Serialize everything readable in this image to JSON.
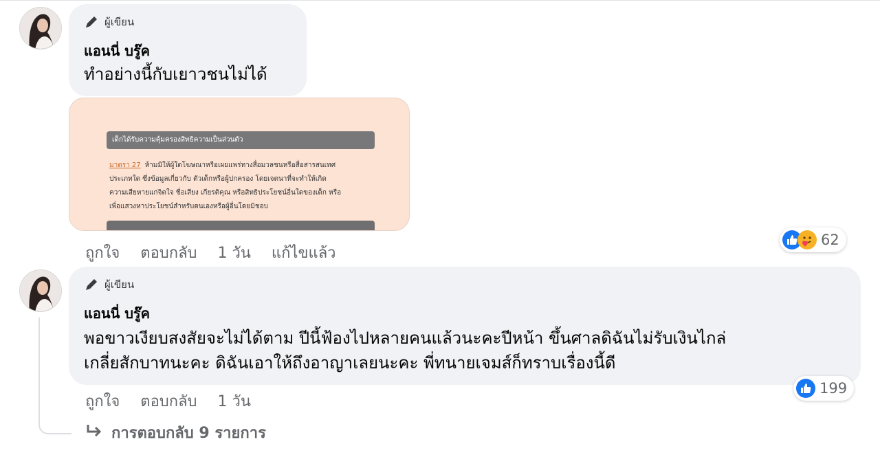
{
  "comments": [
    {
      "author_role": "ผู้เขียน",
      "author_name": "แอนนี่ บรู๊ค",
      "text": "ทำอย่างนี้กับเยาวชนไม่ได้",
      "attachment": {
        "header": "เด็กได้รับความคุ้มครองสิทธิความเป็นส่วนตัว",
        "section": "มาตรา 27",
        "lines": [
          "ห้ามมิให้ผู้ใดโฆษณาหรือเผยแพร่ทางสื่อมวลชนหรือสื่อสารสนเทศ",
          "ประเภทใด ซึ่งข้อมูลเกี่ยวกับ ตัวเด็กหรือผู้ปกครอง โดยเจตนาที่จะทำให้เกิด",
          "ความเสียหายแก่จิตใจ ชื่อเสียง เกียรติคุณ หรือสิทธิประโยชน์อื่นใดของเด็ก หรือ",
          "เพื่อแสวงหาประโยชน์สำหรับตนเองหรือผู้อื่นโดยมิชอบ"
        ]
      },
      "actions": {
        "like": "ถูกใจ",
        "reply": "ตอบกลับ",
        "time": "1 วัน",
        "edited": "แก้ไขแล้ว"
      },
      "reactions": {
        "icons": [
          "like-icon",
          "care-icon"
        ],
        "count": "62"
      }
    },
    {
      "author_role": "ผู้เขียน",
      "author_name": "แอนนี่ บรู๊ค",
      "text": "พอขาวเงียบสงสัยจะไม่ได้ตาม ปีนี้ฟ้องไปหลายคนแล้วนะคะปีหน้า ขึ้นศาลดิฉันไม่รับเงินไกล่\nเกลี่ยสักบาทนะคะ ดิฉันเอาให้ถึงอาญาเลยนะคะ พี่ทนายเจมส์ก็ทราบเรื่องนี้ดี",
      "actions": {
        "like": "ถูกใจ",
        "reply": "ตอบกลับ",
        "time": "1 วัน"
      },
      "reactions": {
        "icons": [
          "like-icon"
        ],
        "count": "199"
      }
    }
  ],
  "replies_link": "การตอบกลับ 9 รายการ",
  "colors": {
    "like_blue": "#1877f2",
    "bubble": "#f0f2f5",
    "meta": "#65676b"
  }
}
